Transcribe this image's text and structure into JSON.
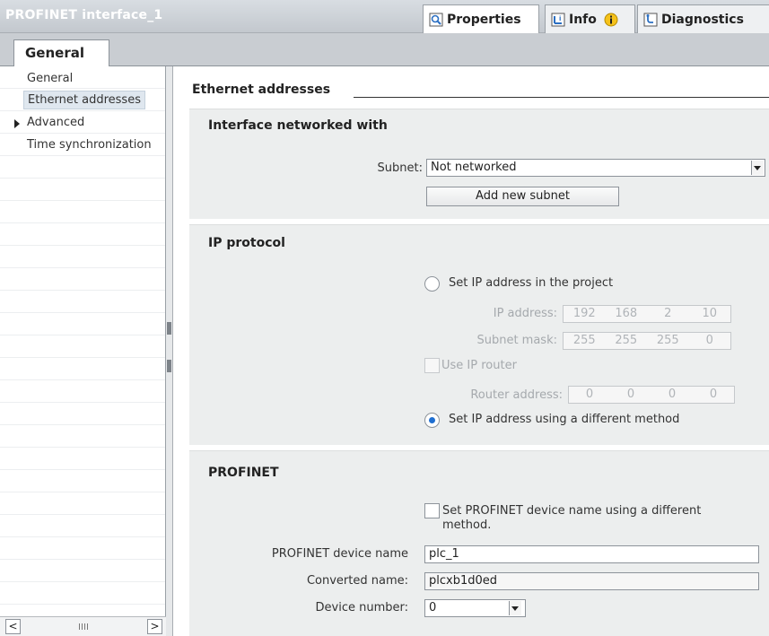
{
  "titlebar": {
    "title": "PROFINET interface_1",
    "tabs": [
      {
        "label": "Properties",
        "icon": "properties-icon"
      },
      {
        "label": "Info",
        "icon": "info-icon"
      },
      {
        "label": "Diagnostics",
        "icon": "diagnostics-icon"
      }
    ]
  },
  "general_tab": {
    "label": "General"
  },
  "sidebar": {
    "items": [
      {
        "label": "General"
      },
      {
        "label": "Ethernet addresses",
        "selected": true
      },
      {
        "label": "Advanced",
        "expandable": true
      },
      {
        "label": "Time synchronization"
      }
    ],
    "scroll_left": "<",
    "scroll_right": ">"
  },
  "content": {
    "heading": "Ethernet addresses",
    "interface": {
      "title": "Interface networked with",
      "subnet_label": "Subnet:",
      "subnet_value": "Not networked",
      "add_subnet_button": "Add new subnet"
    },
    "ip": {
      "title": "IP protocol",
      "set_in_project": "Set IP address in the project",
      "ip_label": "IP address:",
      "ip_value": [
        "192",
        "168",
        "2",
        "10"
      ],
      "mask_label": "Subnet mask:",
      "mask_value": [
        "255",
        "255",
        "255",
        "0"
      ],
      "use_router": "Use IP router",
      "router_label": "Router address:",
      "router_value": [
        "0",
        "0",
        "0",
        "0"
      ],
      "different_method": "Set IP address using a different method"
    },
    "profinet": {
      "title": "PROFINET",
      "set_name_text": "Set PROFINET device name using a different method.",
      "device_name_label": "PROFINET device name",
      "device_name_value": "plc_1",
      "converted_label": "Converted name:",
      "converted_value": "plcxb1d0ed",
      "number_label": "Device number:",
      "number_value": "0"
    }
  },
  "colors": {
    "accent": "#1f6fd1",
    "panel": "#eceeee",
    "sidebar_selected": "#dfe7ef"
  }
}
